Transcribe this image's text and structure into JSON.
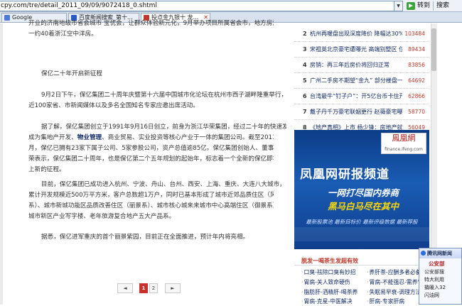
{
  "browser": {
    "url": "cpy.com/tre/detail_2011_09/09/9072418_0.shtml",
    "go_label": "转到",
    "search_label": "搜索",
    "tabs": [
      {
        "label": "Google",
        "active": false,
        "icon_color": "#4a7bd8"
      },
      {
        "label": "百度新闻搜索_第十...",
        "active": false,
        "icon_color": "#2b59c3"
      },
      {
        "label": "投点金九银十 龙...",
        "active": true,
        "icon_color": "#c0392b"
      }
    ]
  },
  "article": {
    "top_line1": "开业的济南地级市省会城市    宝优会，让群众体验新元化，9月举办项目所属省会市，地方房源一一一",
    "top_line2": "一约40着浙江空中洋房。",
    "section_title": "保亿二十年开启新征程",
    "paragraphs": [
      [
        "9月2日下午，保亿集团二十周年庆暨第十六届中国城市化论坛在杭州市西子湖畔隆重举行，",
        "近100家省、市新闻媒体以及多名全国知名专家应邀出席活动。"
      ],
      [
        "据了解，保亿集团创立于1991年9月16日创立，前身为浙江华荣集团，经过二十年的快速发展，已",
        {
          "pre": "成为集地产开发、",
          "link": "物业管理",
          "post": "、商业贸易、实业投资等核心产业于一体的集团公司。截至2011年9"
        },
        "月，保亿已拥有23家下属子公司、5家参股公司，资产总值逾85亿。保亿集团创始人、董事长莫剑",
        "荣表示，保亿集团二十周年，也是保亿第二个五年规划的起始年，标志着一个全新的保亿即将踏",
        "上新的征程。"
      ],
      [
        "目前，保亿集团已成功进入杭州、宁波、舟山、台州、西安、上海、重庆、大连八大城市，",
        "累计开发规模近500万平方米，客户总数超1万户，同时已基本形成了城市近郊品质住区（风景",
        "系）、城市新城功能区品质改善住区（丽景系）、城市核心城来来城市中心高端住区（御景系）、",
        "城市新区产业写字楼、老年旅游复合地产五大产品系。"
      ],
      [
        "据悉，保亿进军重庆的首个丽景紫园，目前正在全面推进，预计年内将亮相。"
      ]
    ],
    "pagination": {
      "prev": "◄",
      "pages": [
        "1",
        "2"
      ],
      "current": "1",
      "next": "►"
    }
  },
  "rank_list": {
    "items": [
      {
        "num": "2",
        "title": "杭州再暖盘出现深度降价 降幅达30%",
        "count": "103484"
      },
      {
        "num": "3",
        "title": "宋祖英北京豪宅遭曝光 高端别墅区 位置",
        "count": "89434"
      },
      {
        "num": "4",
        "title": "房销：再三年后房价将回归正常",
        "count": "83856"
      },
      {
        "num": "5",
        "title": "广州二手房不期望“金九” 部分楼盘一",
        "count": "64692"
      },
      {
        "num": "6",
        "title": "台湾最牛“钉子户”：开5亿台币卡住开",
        "count": "62866"
      },
      {
        "num": "7",
        "title": "戴子丹千万豪宅联姻更行 赵薇豪宅曝",
        "count": "58770"
      },
      {
        "num": "8",
        "title": "《地产真相》上市 杨少锋：房地产就像",
        "count": "56049"
      }
    ]
  },
  "ad": {
    "logo_cn": "鳳凰網",
    "logo_url": "finance.ifeng.com",
    "title": "凤凰网研报频道",
    "line1": "一网打尽国内券商",
    "line2": "黑马白马尽在其中",
    "tagline": "最新股票池 最新目标价 最新评级数据 最新荐股",
    "colors": {
      "bg": "#0c3d86",
      "accent": "#ffd700"
    }
  },
  "bottom_list": {
    "header": "脱发一喝茶生发超有效",
    "items": [
      [
        "口臭-祛除口臭有妙招",
        "养肝茶-应酬多者必备"
      ],
      [
        "胃病-关人致命硬伤",
        "胃病-不能强忍-需养胃"
      ],
      [
        "脂肪肝-洒精肝-喝茶养",
        "失眠易早衰-调理方法"
      ],
      [
        "胃病-克星-中医解决",
        "肝病-专家肝病"
      ]
    ]
  },
  "news_popup": {
    "title": "腾讯网新闻",
    "subtitle": "公安部",
    "lines": [
      "公安部搜",
      "特大利用",
      "撬暖入32",
      "闪油网"
    ]
  }
}
